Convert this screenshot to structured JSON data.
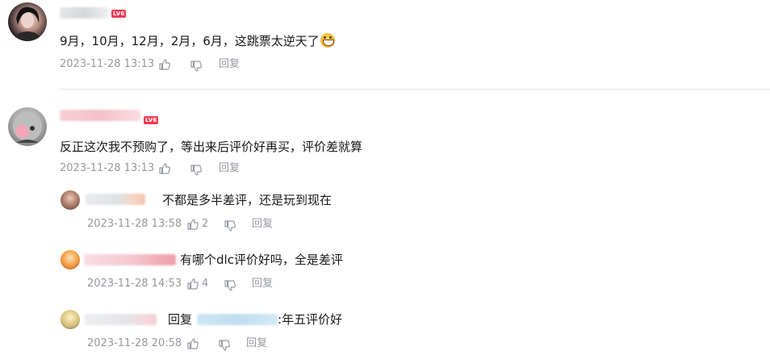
{
  "colors": {
    "meta": "#9499a0",
    "text": "#18191c",
    "level_badge": "#f4384f",
    "divider": "#e3e5e7"
  },
  "comments": [
    {
      "level": "LV6",
      "content": "9月，10月，12月，2月，6月，这跳票太逆天了",
      "emoji": "grin-emoji",
      "time": "2023-11-28 13:13",
      "like_count": "",
      "reply_label": "回复"
    },
    {
      "level": "LV6",
      "content": "反正这次我不预购了，等出来后评价好再买，评价差就算",
      "time": "2023-11-28 13:13",
      "like_count": "",
      "reply_label": "回复",
      "replies": [
        {
          "content": "不都是多半差评，还是玩到现在",
          "time": "2023-11-28 13:58",
          "like_count": "2",
          "reply_label": "回复"
        },
        {
          "content": "有哪个dlc评价好吗，全是差评",
          "time": "2023-11-28 14:53",
          "like_count": "4",
          "reply_label": "回复"
        },
        {
          "reply_prefix": "回复",
          "content": ":年五评价好",
          "time": "2023-11-28 20:58",
          "like_count": "",
          "reply_label": "回复"
        }
      ]
    }
  ]
}
